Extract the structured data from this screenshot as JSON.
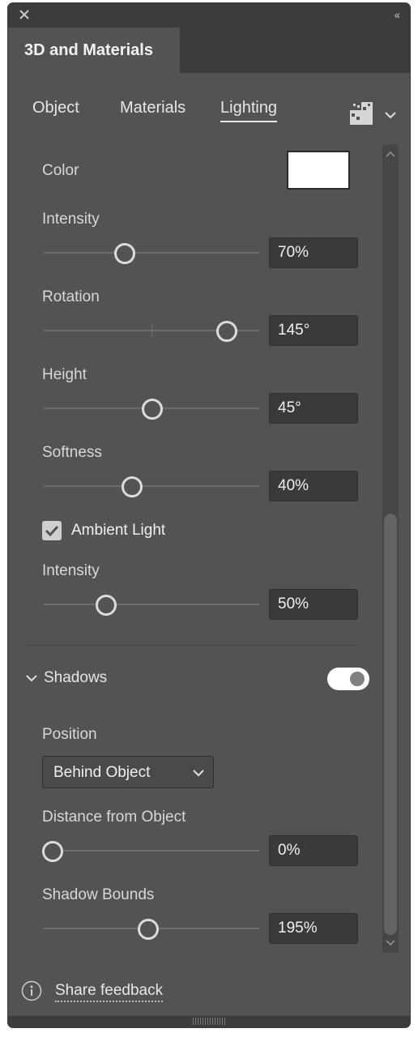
{
  "panel": {
    "title": "3D and Materials",
    "collapse_glyph": "‹‹"
  },
  "tabs": [
    {
      "label": "Object",
      "active": false
    },
    {
      "label": "Materials",
      "active": false
    },
    {
      "label": "Lighting",
      "active": true
    }
  ],
  "lighting": {
    "color_label": "Color",
    "color_value": "#ffffff",
    "intensity": {
      "label": "Intensity",
      "value_text": "70%",
      "level": 0.36
    },
    "rotation": {
      "label": "Rotation",
      "value_text": "145°",
      "level": 0.875
    },
    "height": {
      "label": "Height",
      "value_text": "45°",
      "level": 0.5
    },
    "softness": {
      "label": "Softness",
      "value_text": "40%",
      "level": 0.4
    },
    "ambient": {
      "label": "Ambient Light",
      "checked": true
    },
    "ambient_intensity": {
      "label": "Intensity",
      "value_text": "50%",
      "level": 0.27
    }
  },
  "shadows": {
    "section_label": "Shadows",
    "enabled": true,
    "position_label": "Position",
    "position_value": "Behind Object",
    "distance": {
      "label": "Distance from Object",
      "value_text": "0%",
      "level": 0.0
    },
    "bounds": {
      "label": "Shadow Bounds",
      "value_text": "195%",
      "level": 0.48
    }
  },
  "footer": {
    "feedback_label": "Share feedback"
  },
  "icons": {
    "close": "close-icon",
    "collapse": "collapse-panel-icon",
    "presets": "lighting-presets-icon",
    "chevron": "chevron-down-icon",
    "info": "info-icon"
  }
}
